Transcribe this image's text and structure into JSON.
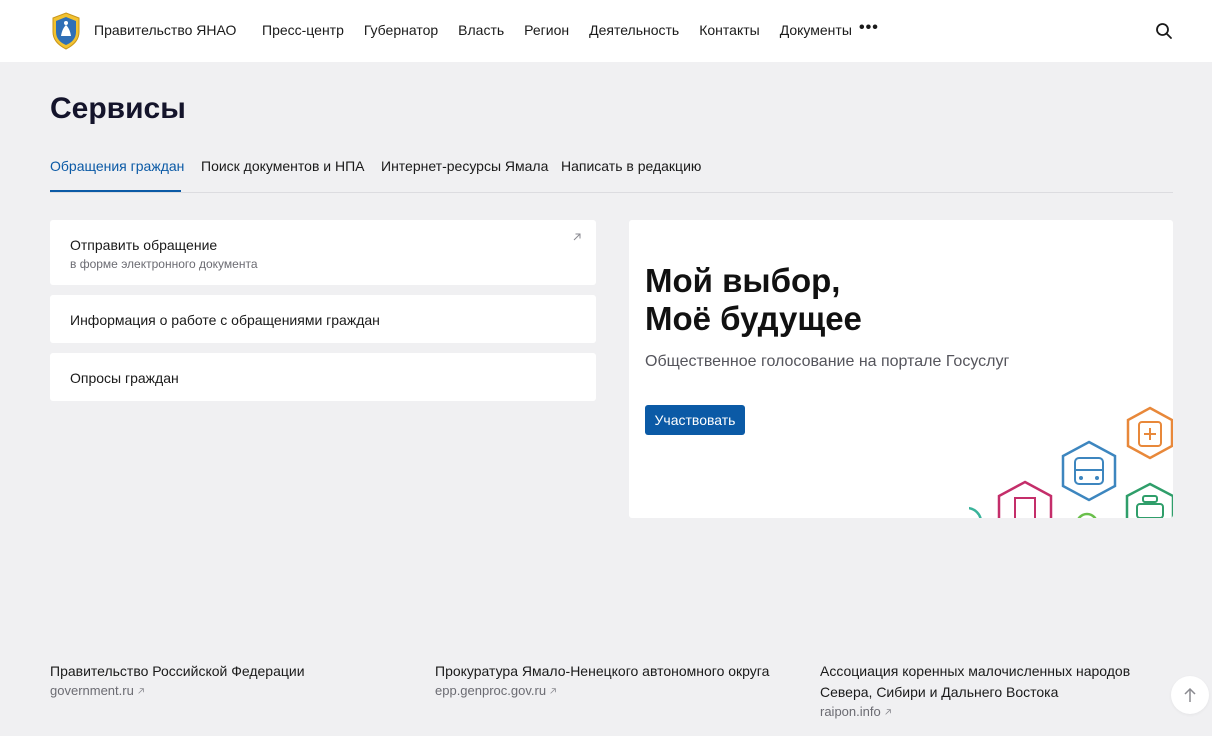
{
  "header": {
    "brand": "Правительство ЯНАО",
    "nav": [
      "Пресс-центр",
      "Губернатор",
      "Власть",
      "Регион",
      "Деятельность",
      "Контакты",
      "Документы"
    ],
    "more": "•••"
  },
  "page": {
    "title": "Сервисы"
  },
  "tabs": [
    {
      "label": "Обращения граждан",
      "active": true
    },
    {
      "label": "Поиск документов и НПА",
      "active": false
    },
    {
      "label": "Интернет-ресурсы Ямала",
      "active": false
    },
    {
      "label": "Написать в редакцию",
      "active": false
    }
  ],
  "cards": [
    {
      "title": "Отправить обращение",
      "subtitle": "в форме электронного документа"
    },
    {
      "title": "Информация о работе с обращениями граждан"
    },
    {
      "title": "Опросы граждан"
    }
  ],
  "promo": {
    "title_line1": "Мой выбор,",
    "title_line2": "Моё будущее",
    "subtitle": "Общественное голосование на портале Госуслуг",
    "button": "Участвовать"
  },
  "footer": [
    {
      "title": "Правительство Российской Федерации",
      "link": "government.ru"
    },
    {
      "title": "Прокуратура Ямало-Ненецкого автономного округа",
      "link": "epp.genproc.gov.ru"
    },
    {
      "title": "Ассоциация коренных малочисленных народов Севера, Сибири и Дальнего Востока",
      "link": "raipon.info"
    }
  ],
  "colors": {
    "accent": "#0b5aa6",
    "background": "#f0f0f2"
  },
  "icons": [
    "emblem-icon",
    "search-icon",
    "external-link-icon",
    "arrow-up-icon"
  ]
}
